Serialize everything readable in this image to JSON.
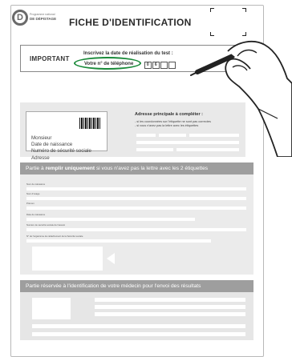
{
  "header": {
    "logo_top": "Programme national",
    "logo_bottom": "DE DÉPISTAGE",
    "title": "FICHE D'IDENTIFICATION"
  },
  "important": {
    "label": "IMPORTANT",
    "line1": "Inscrivez la date de réalisation du test :",
    "line2": "Votre n° de téléphone",
    "digits": [
      "0",
      "6"
    ]
  },
  "address_section": {
    "card_lines": [
      "Monsieur",
      "Date de naissance",
      "Numéro de sécurité sociale",
      "Adresse"
    ],
    "title": "Adresse principale à compléter :",
    "notes": [
      "- si les coordonnées sur l'étiquette ne sont pas correctes",
      "- si vous n'avez pas la lettre avec les étiquettes"
    ]
  },
  "form_section": {
    "band_prefix": "Partie à ",
    "band_bold": "remplir uniquement",
    "band_suffix": " si vous n'avez pas la lettre avec les 2 étiquettes",
    "rows": [
      "Nom de naissance",
      "Nom d'usage",
      "Prénom",
      "Date de naissance",
      "Numéro de sécurité sociale de l'assuré",
      "N° de l'organisme de rattachement de la Sécurité sociale"
    ]
  },
  "result_section": {
    "band": "Partie réservée à l'identification de votre médecin pour l'envoi des résultats"
  },
  "colors": {
    "highlight_oval": "#1a8a3a",
    "band": "#9e9e9e",
    "panel": "#ebebeb"
  }
}
